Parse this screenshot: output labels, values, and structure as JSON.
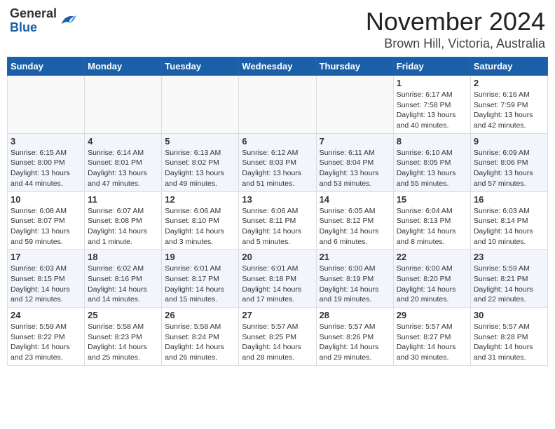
{
  "header": {
    "logo_general": "General",
    "logo_blue": "Blue",
    "month_title": "November 2024",
    "location": "Brown Hill, Victoria, Australia"
  },
  "days_of_week": [
    "Sunday",
    "Monday",
    "Tuesday",
    "Wednesday",
    "Thursday",
    "Friday",
    "Saturday"
  ],
  "weeks": [
    [
      {
        "day": "",
        "info": ""
      },
      {
        "day": "",
        "info": ""
      },
      {
        "day": "",
        "info": ""
      },
      {
        "day": "",
        "info": ""
      },
      {
        "day": "",
        "info": ""
      },
      {
        "day": "1",
        "info": "Sunrise: 6:17 AM\nSunset: 7:58 PM\nDaylight: 13 hours\nand 40 minutes."
      },
      {
        "day": "2",
        "info": "Sunrise: 6:16 AM\nSunset: 7:59 PM\nDaylight: 13 hours\nand 42 minutes."
      }
    ],
    [
      {
        "day": "3",
        "info": "Sunrise: 6:15 AM\nSunset: 8:00 PM\nDaylight: 13 hours\nand 44 minutes."
      },
      {
        "day": "4",
        "info": "Sunrise: 6:14 AM\nSunset: 8:01 PM\nDaylight: 13 hours\nand 47 minutes."
      },
      {
        "day": "5",
        "info": "Sunrise: 6:13 AM\nSunset: 8:02 PM\nDaylight: 13 hours\nand 49 minutes."
      },
      {
        "day": "6",
        "info": "Sunrise: 6:12 AM\nSunset: 8:03 PM\nDaylight: 13 hours\nand 51 minutes."
      },
      {
        "day": "7",
        "info": "Sunrise: 6:11 AM\nSunset: 8:04 PM\nDaylight: 13 hours\nand 53 minutes."
      },
      {
        "day": "8",
        "info": "Sunrise: 6:10 AM\nSunset: 8:05 PM\nDaylight: 13 hours\nand 55 minutes."
      },
      {
        "day": "9",
        "info": "Sunrise: 6:09 AM\nSunset: 8:06 PM\nDaylight: 13 hours\nand 57 minutes."
      }
    ],
    [
      {
        "day": "10",
        "info": "Sunrise: 6:08 AM\nSunset: 8:07 PM\nDaylight: 13 hours\nand 59 minutes."
      },
      {
        "day": "11",
        "info": "Sunrise: 6:07 AM\nSunset: 8:08 PM\nDaylight: 14 hours\nand 1 minute."
      },
      {
        "day": "12",
        "info": "Sunrise: 6:06 AM\nSunset: 8:10 PM\nDaylight: 14 hours\nand 3 minutes."
      },
      {
        "day": "13",
        "info": "Sunrise: 6:06 AM\nSunset: 8:11 PM\nDaylight: 14 hours\nand 5 minutes."
      },
      {
        "day": "14",
        "info": "Sunrise: 6:05 AM\nSunset: 8:12 PM\nDaylight: 14 hours\nand 6 minutes."
      },
      {
        "day": "15",
        "info": "Sunrise: 6:04 AM\nSunset: 8:13 PM\nDaylight: 14 hours\nand 8 minutes."
      },
      {
        "day": "16",
        "info": "Sunrise: 6:03 AM\nSunset: 8:14 PM\nDaylight: 14 hours\nand 10 minutes."
      }
    ],
    [
      {
        "day": "17",
        "info": "Sunrise: 6:03 AM\nSunset: 8:15 PM\nDaylight: 14 hours\nand 12 minutes."
      },
      {
        "day": "18",
        "info": "Sunrise: 6:02 AM\nSunset: 8:16 PM\nDaylight: 14 hours\nand 14 minutes."
      },
      {
        "day": "19",
        "info": "Sunrise: 6:01 AM\nSunset: 8:17 PM\nDaylight: 14 hours\nand 15 minutes."
      },
      {
        "day": "20",
        "info": "Sunrise: 6:01 AM\nSunset: 8:18 PM\nDaylight: 14 hours\nand 17 minutes."
      },
      {
        "day": "21",
        "info": "Sunrise: 6:00 AM\nSunset: 8:19 PM\nDaylight: 14 hours\nand 19 minutes."
      },
      {
        "day": "22",
        "info": "Sunrise: 6:00 AM\nSunset: 8:20 PM\nDaylight: 14 hours\nand 20 minutes."
      },
      {
        "day": "23",
        "info": "Sunrise: 5:59 AM\nSunset: 8:21 PM\nDaylight: 14 hours\nand 22 minutes."
      }
    ],
    [
      {
        "day": "24",
        "info": "Sunrise: 5:59 AM\nSunset: 8:22 PM\nDaylight: 14 hours\nand 23 minutes."
      },
      {
        "day": "25",
        "info": "Sunrise: 5:58 AM\nSunset: 8:23 PM\nDaylight: 14 hours\nand 25 minutes."
      },
      {
        "day": "26",
        "info": "Sunrise: 5:58 AM\nSunset: 8:24 PM\nDaylight: 14 hours\nand 26 minutes."
      },
      {
        "day": "27",
        "info": "Sunrise: 5:57 AM\nSunset: 8:25 PM\nDaylight: 14 hours\nand 28 minutes."
      },
      {
        "day": "28",
        "info": "Sunrise: 5:57 AM\nSunset: 8:26 PM\nDaylight: 14 hours\nand 29 minutes."
      },
      {
        "day": "29",
        "info": "Sunrise: 5:57 AM\nSunset: 8:27 PM\nDaylight: 14 hours\nand 30 minutes."
      },
      {
        "day": "30",
        "info": "Sunrise: 5:57 AM\nSunset: 8:28 PM\nDaylight: 14 hours\nand 31 minutes."
      }
    ]
  ]
}
